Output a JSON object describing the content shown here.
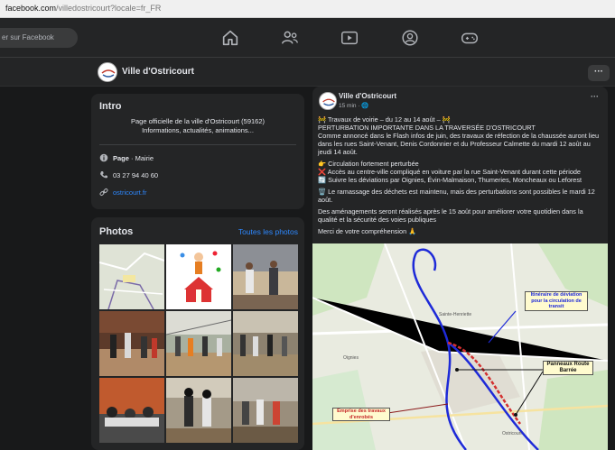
{
  "browser": {
    "url_host": "facebook.com",
    "url_path": "/villedostricourt?locale=fr_FR"
  },
  "nav": {
    "search_placeholder": "er sur Facebook"
  },
  "page": {
    "name": "Ville d'Ostricourt"
  },
  "intro": {
    "title": "Intro",
    "description_line1": "Page officielle de la ville d'Ostricourt (59162)",
    "description_line2": "Informations, actualités, animations...",
    "category_bold": "Page",
    "category_rest": " · Mairie",
    "phone": "03 27 94 40 60",
    "website": "ostricourt.fr"
  },
  "photos": {
    "title": "Photos",
    "see_all": "Toutes les photos"
  },
  "post": {
    "author": "Ville d'Ostricourt",
    "time": "15 min · ",
    "line1": "🚧 Travaux de voirie – du 12 au 14 août – 🚧",
    "line2": "PERTURBATION IMPORTANTE DANS LA TRAVERSÉE D'OSTRICOURT",
    "para1": "Comme annoncé dans le Flash infos de juin, des travaux de réfection de la chaussée auront lieu dans les rues Saint-Venant, Denis Cordonnier et du Professeur Calmette du mardi 12 août au jeudi 14 août.",
    "b1": "👉 Circulation fortement perturbée",
    "b2": "❌ Accès au centre-ville compliqué en voiture par la rue Saint-Venant durant cette période",
    "b3": "🔄 Suivre les déviations par Oignies, Évin-Malmaison, Thumeries, Moncheaux ou Leforest",
    "b4": "🗑️ Le ramassage des déchets est maintenu, mais des perturbations sont possibles le mardi 12 août.",
    "para2": "Des aménagements seront réalisés après le 15 août pour améliorer votre quotidien dans la qualité et la sécurité des voies publiques",
    "para3": "Merci de votre compréhension 🙏"
  },
  "map": {
    "label_deviation": "Itinéraire de déviation pour la circulation de transit",
    "label_panneaux": "Panneaux Route Barrée",
    "label_emprise": "Emprise des travaux d'enrobés",
    "town_oignies": "Oignies",
    "town_ostricourt": "Ostricourt",
    "town_sainte": "Sainte-Henriette"
  },
  "colors": {
    "accent": "#2d88ff",
    "bg": "#18191a",
    "card": "#242526"
  }
}
